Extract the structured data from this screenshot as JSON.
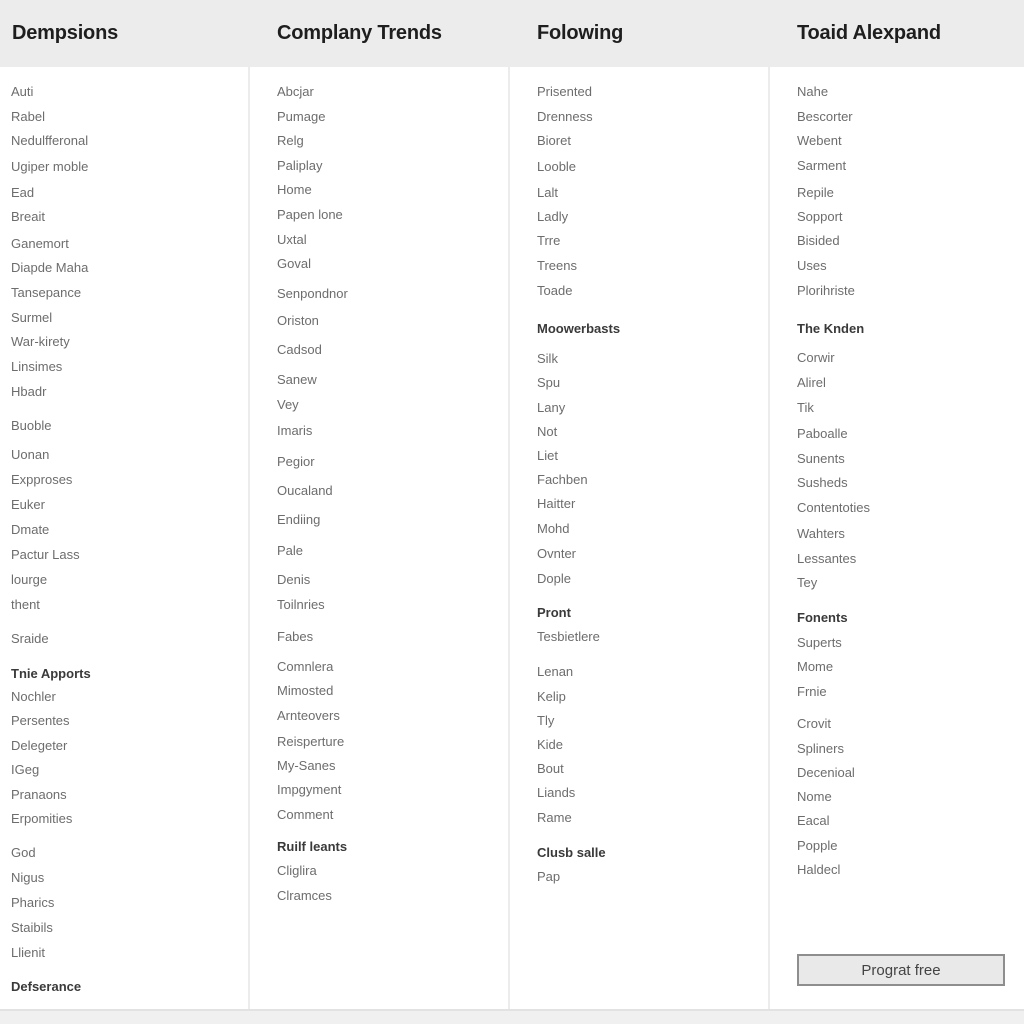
{
  "columns": [
    {
      "title": "Dempsions",
      "items": [
        {
          "label": "Auti"
        },
        {
          "label": "Rabel"
        },
        {
          "label": "Nedulfferonal"
        },
        {
          "label": "Ugiper moble"
        },
        {
          "label": "Ead"
        },
        {
          "label": "Breait"
        },
        {
          "label": "Ganemort"
        },
        {
          "label": "Diapde Maha"
        },
        {
          "label": "Tansepance"
        },
        {
          "label": "Surmel"
        },
        {
          "label": "War-kirety"
        },
        {
          "label": "Linsimes"
        },
        {
          "label": "Hbadr"
        },
        {
          "label": "Buoble"
        },
        {
          "label": "Uonan"
        },
        {
          "label": "Expproses"
        },
        {
          "label": "Euker"
        },
        {
          "label": "Dmate"
        },
        {
          "label": "Pactur Lass"
        },
        {
          "label": "lourge"
        },
        {
          "label": "thent"
        },
        {
          "label": "Sraide"
        },
        {
          "label": "Tnie Apports",
          "header": true
        },
        {
          "label": "Nochler"
        },
        {
          "label": "Persentes"
        },
        {
          "label": "Delegeter"
        },
        {
          "label": "IGeg"
        },
        {
          "label": "Pranaons"
        },
        {
          "label": "Erpomities"
        },
        {
          "label": "God"
        },
        {
          "label": "Nigus"
        },
        {
          "label": "Pharics"
        },
        {
          "label": "Staibils"
        },
        {
          "label": "Llienit"
        },
        {
          "label": "Defserance",
          "header": true
        }
      ]
    },
    {
      "title": "Complany Trends",
      "items": [
        {
          "label": "Abcjar"
        },
        {
          "label": "Pumage"
        },
        {
          "label": "Relg"
        },
        {
          "label": "Paliplay"
        },
        {
          "label": "Home"
        },
        {
          "label": "Papen lone"
        },
        {
          "label": "Uxtal"
        },
        {
          "label": "Goval"
        },
        {
          "label": "Senpondnor"
        },
        {
          "label": "Oriston"
        },
        {
          "label": "Cadsod"
        },
        {
          "label": "Sanew"
        },
        {
          "label": "Vey"
        },
        {
          "label": "Imaris"
        },
        {
          "label": "Pegior"
        },
        {
          "label": "Oucaland"
        },
        {
          "label": "Endiing"
        },
        {
          "label": "Pale"
        },
        {
          "label": "Denis"
        },
        {
          "label": "Toilnries"
        },
        {
          "label": "Fabes"
        },
        {
          "label": "Comnlera"
        },
        {
          "label": "Mimosted"
        },
        {
          "label": "Arnteovers"
        },
        {
          "label": "Reisperture"
        },
        {
          "label": "My-Sanes"
        },
        {
          "label": "Impgyment"
        },
        {
          "label": "Comment"
        },
        {
          "label": "Ruilf leants",
          "header": true
        },
        {
          "label": "Cliglira"
        },
        {
          "label": "Clramces"
        }
      ]
    },
    {
      "title": "Folowing",
      "items": [
        {
          "label": "Prisented"
        },
        {
          "label": "Drenness"
        },
        {
          "label": "Bioret"
        },
        {
          "label": "Looble"
        },
        {
          "label": "Lalt"
        },
        {
          "label": "Ladly"
        },
        {
          "label": "Trre"
        },
        {
          "label": "Treens"
        },
        {
          "label": "Toade"
        },
        {
          "label": "Moowerbasts",
          "header": true
        },
        {
          "label": "Silk"
        },
        {
          "label": "Spu"
        },
        {
          "label": "Lany"
        },
        {
          "label": "Not"
        },
        {
          "label": "Liet"
        },
        {
          "label": "Fachben"
        },
        {
          "label": "Haitter"
        },
        {
          "label": "Mohd"
        },
        {
          "label": "Ovnter"
        },
        {
          "label": "Dople"
        },
        {
          "label": "Pront",
          "header": true
        },
        {
          "label": "Tesbietlere"
        },
        {
          "label": "Lenan"
        },
        {
          "label": "Kelip"
        },
        {
          "label": "Tly"
        },
        {
          "label": "Kide"
        },
        {
          "label": "Bout"
        },
        {
          "label": "Liands"
        },
        {
          "label": "Rame"
        },
        {
          "label": "Clusb salle",
          "header": true
        },
        {
          "label": "Pap"
        }
      ]
    },
    {
      "title": "Toaid Alexpand",
      "items": [
        {
          "label": "Nahe"
        },
        {
          "label": "Bescorter"
        },
        {
          "label": "Webent"
        },
        {
          "label": "Sarment"
        },
        {
          "label": "Repile"
        },
        {
          "label": "Sopport"
        },
        {
          "label": "Bisided"
        },
        {
          "label": "Uses"
        },
        {
          "label": "Plorihriste"
        },
        {
          "label": "The Knden",
          "header": true
        },
        {
          "label": "Corwir"
        },
        {
          "label": "Alirel"
        },
        {
          "label": "Tik"
        },
        {
          "label": "Paboalle"
        },
        {
          "label": "Sunents"
        },
        {
          "label": "Susheds"
        },
        {
          "label": "Contentoties"
        },
        {
          "label": "Wahters"
        },
        {
          "label": "Lessantes"
        },
        {
          "label": "Tey"
        },
        {
          "label": "Fonents",
          "header": true
        },
        {
          "label": "Superts"
        },
        {
          "label": "Mome"
        },
        {
          "label": "Frnie"
        },
        {
          "label": "Crovit"
        },
        {
          "label": "Spliners"
        },
        {
          "label": "Decenioal"
        },
        {
          "label": "Nome"
        },
        {
          "label": "Eacal"
        },
        {
          "label": "Popple"
        },
        {
          "label": "Haldecl"
        }
      ],
      "button_label": "Prograt free"
    }
  ]
}
